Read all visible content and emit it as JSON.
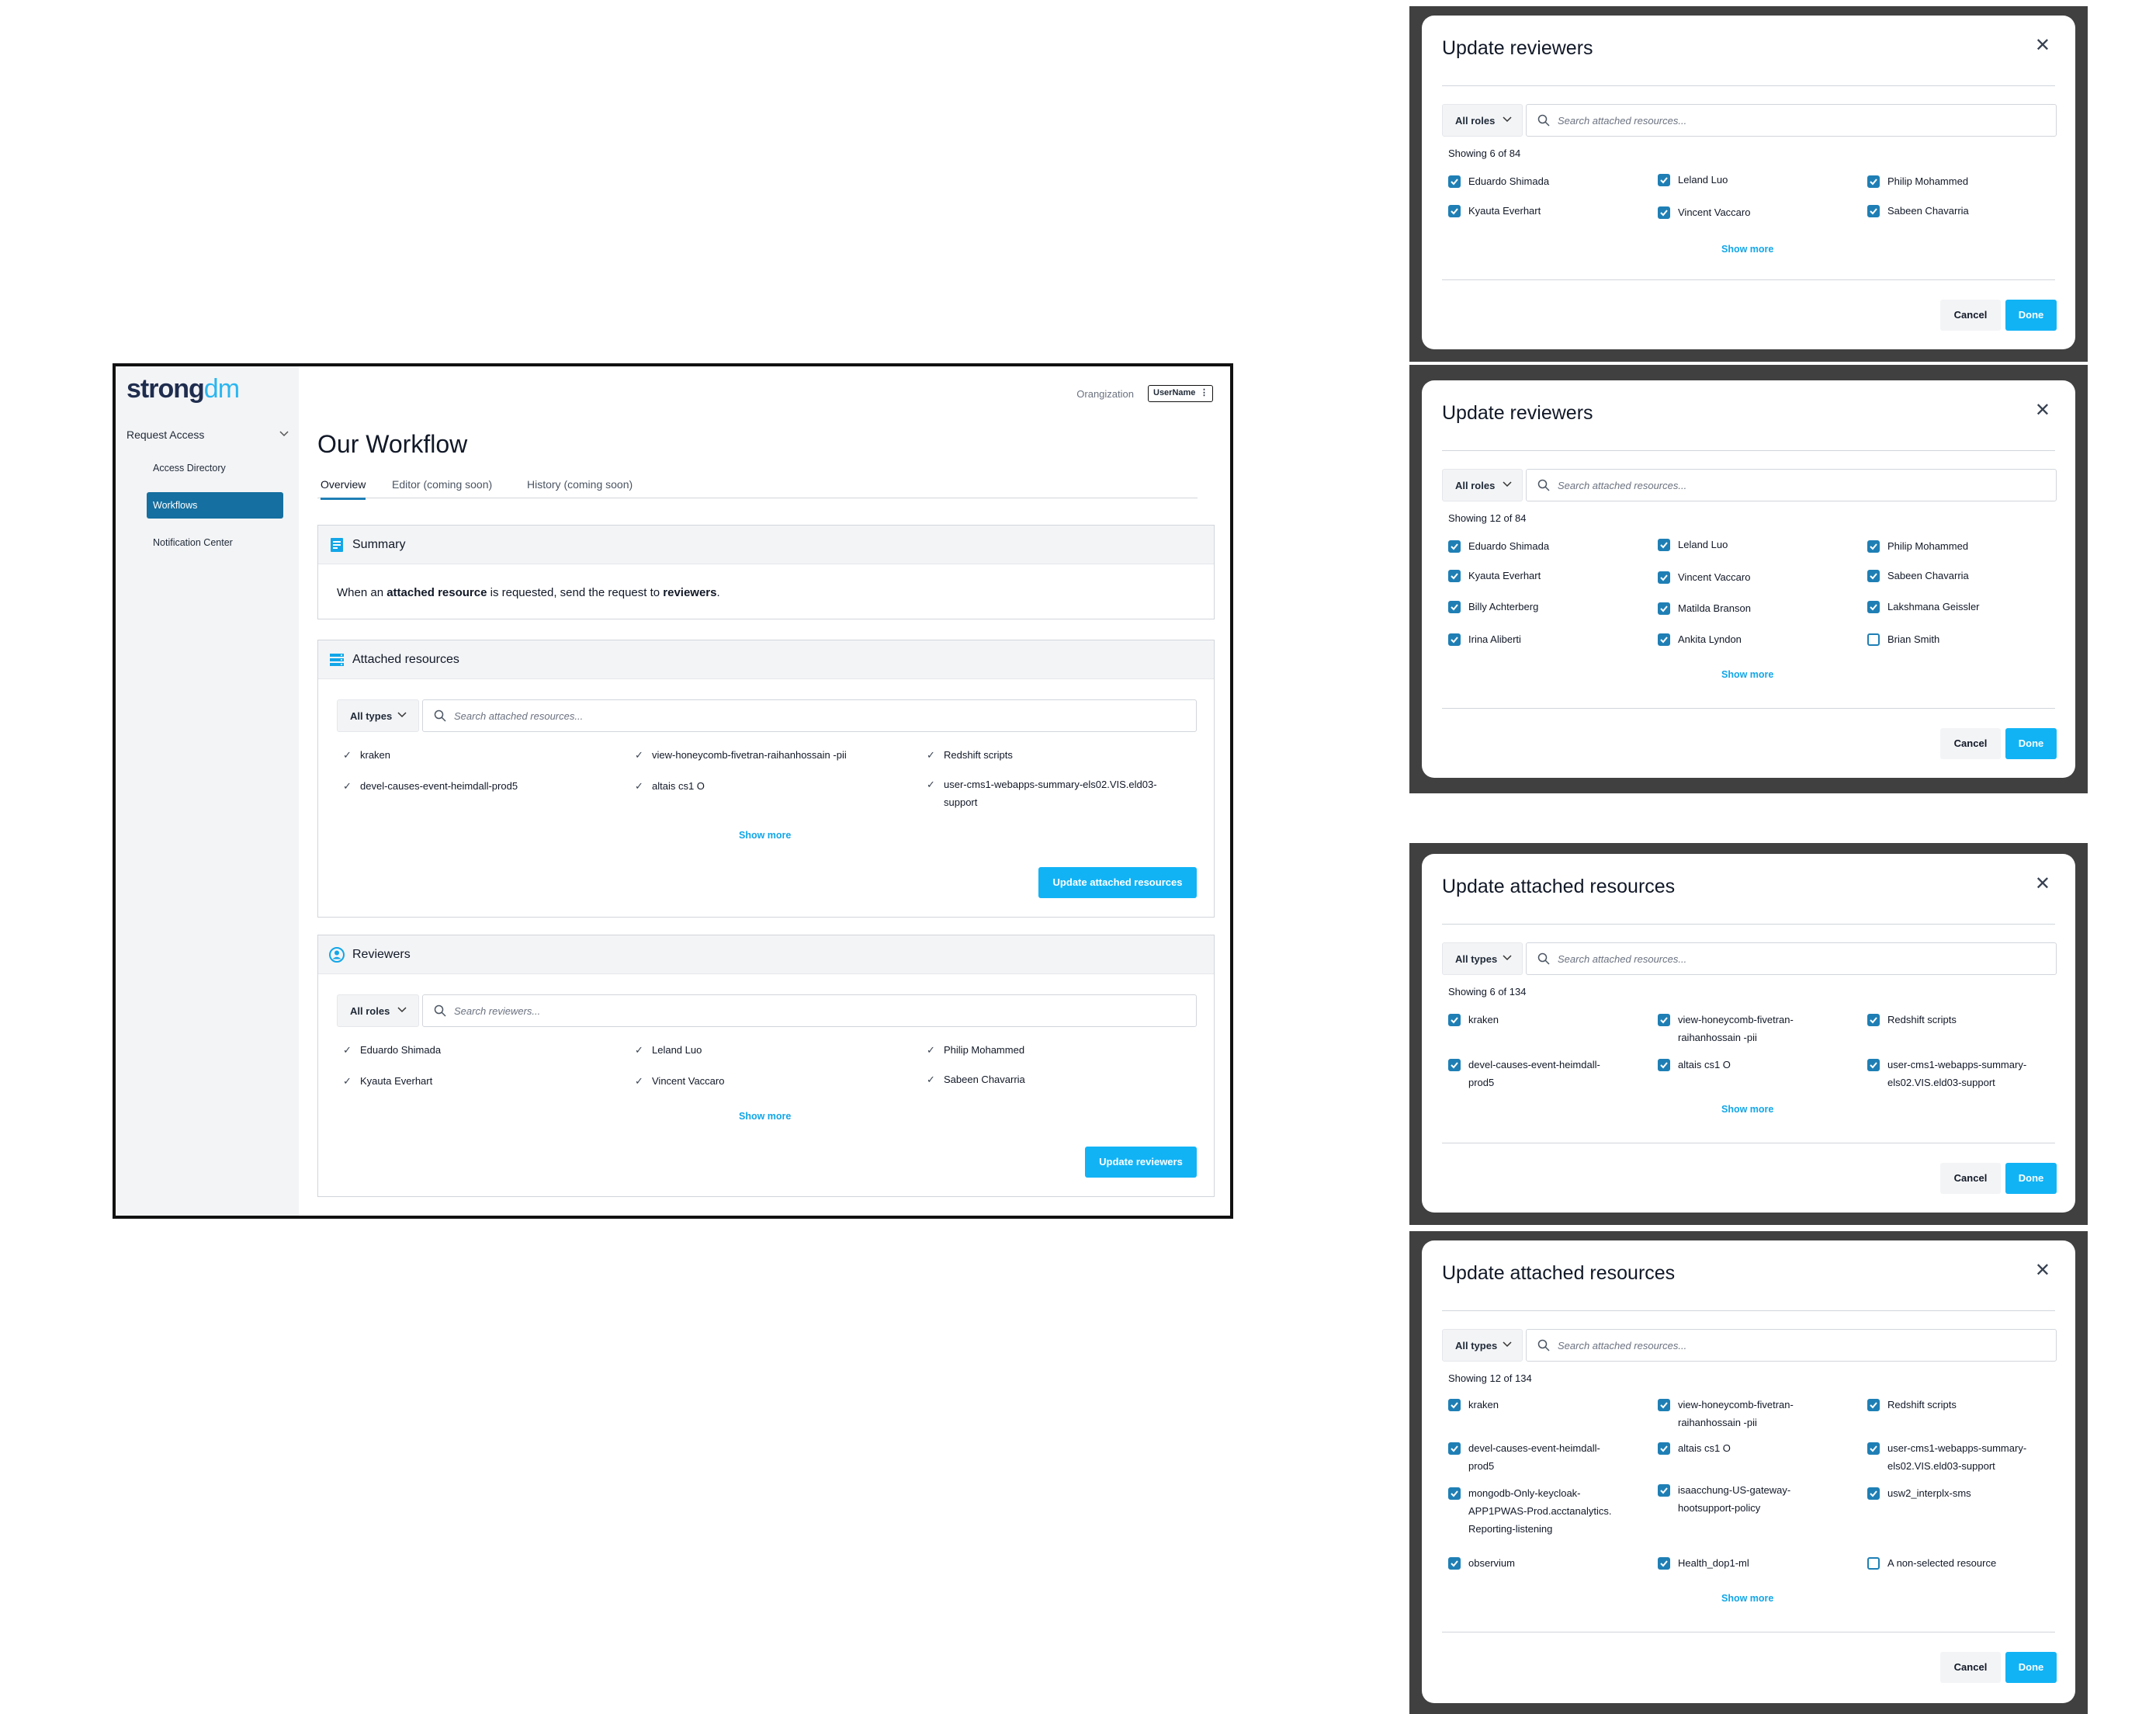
{
  "app": {
    "logo": {
      "part1": "strong",
      "part2": "dm"
    },
    "sidebar": {
      "section": "Request Access",
      "items": [
        {
          "label": "Access Directory",
          "active": false
        },
        {
          "label": "Workflows",
          "active": true
        },
        {
          "label": "Notification Center",
          "active": false
        }
      ]
    },
    "header": {
      "organization_label": "Orangization",
      "user_button": "UserName"
    },
    "page_title": "Our Workflow",
    "tabs": [
      "Overview",
      "Editor (coming soon)",
      "History (coming soon)"
    ],
    "summary": {
      "title": "Summary",
      "text_parts": [
        "When an ",
        "attached resource",
        " is requested, send the request to ",
        "reviewers",
        "."
      ]
    },
    "attached_resources": {
      "title": "Attached resources",
      "filter": "All types",
      "search_placeholder": "Search attached resources...",
      "items": [
        "kraken",
        "view-honeycomb-fivetran-raihanhossain -pii",
        "Redshift scripts",
        "devel-causes-event-heimdall-prod5",
        "altais cs1 O",
        "user-cms1-webapps-summary-els02.VIS.eld03-support"
      ],
      "show_more": "Show more",
      "button": "Update attached resources"
    },
    "reviewers": {
      "title": "Reviewers",
      "filter": "All roles",
      "search_placeholder": "Search reviewers...",
      "items": [
        "Eduardo Shimada",
        "Leland Luo",
        "Philip Mohammed",
        "Kyauta Everhart",
        "Vincent Vaccaro",
        "Sabeen Chavarria"
      ],
      "show_more": "Show more",
      "button": "Update reviewers"
    }
  },
  "modals": [
    {
      "title": "Update reviewers",
      "filter": "All roles",
      "search_placeholder": "Search attached resources...",
      "showing": "Showing 6 of 84",
      "items": [
        {
          "label": "Eduardo Shimada",
          "checked": true
        },
        {
          "label": "Leland Luo",
          "checked": true
        },
        {
          "label": "Philip Mohammed",
          "checked": true
        },
        {
          "label": "Kyauta Everhart",
          "checked": true
        },
        {
          "label": "Vincent Vaccaro",
          "checked": true
        },
        {
          "label": "Sabeen Chavarria",
          "checked": true
        }
      ],
      "show_more": "Show more",
      "cancel": "Cancel",
      "done": "Done"
    },
    {
      "title": "Update reviewers",
      "filter": "All roles",
      "search_placeholder": "Search attached resources...",
      "showing": "Showing 12 of 84",
      "items": [
        {
          "label": "Eduardo Shimada",
          "checked": true
        },
        {
          "label": "Leland Luo",
          "checked": true
        },
        {
          "label": "Philip Mohammed",
          "checked": true
        },
        {
          "label": "Kyauta Everhart",
          "checked": true
        },
        {
          "label": "Vincent Vaccaro",
          "checked": true
        },
        {
          "label": "Sabeen Chavarria",
          "checked": true
        },
        {
          "label": "Billy Achterberg",
          "checked": true
        },
        {
          "label": "Matilda Branson",
          "checked": true
        },
        {
          "label": "Lakshmana Geissler",
          "checked": true
        },
        {
          "label": "Irina Aliberti",
          "checked": true
        },
        {
          "label": "Ankita Lyndon",
          "checked": true
        },
        {
          "label": "Brian Smith",
          "checked": false
        }
      ],
      "show_more": "Show more",
      "cancel": "Cancel",
      "done": "Done"
    },
    {
      "title": "Update attached resources",
      "filter": "All types",
      "search_placeholder": "Search attached resources...",
      "showing": "Showing 6 of 134",
      "items": [
        {
          "label": "kraken",
          "checked": true
        },
        {
          "label": "view-honeycomb-fivetran-\nraihanhossain -pii",
          "checked": true
        },
        {
          "label": "Redshift scripts",
          "checked": true
        },
        {
          "label": "devel-causes-event-heimdall-\nprod5",
          "checked": true
        },
        {
          "label": "altais cs1 O",
          "checked": true
        },
        {
          "label": "user-cms1-webapps-summary-\nels02.VIS.eld03-support",
          "checked": true
        }
      ],
      "show_more": "Show more",
      "cancel": "Cancel",
      "done": "Done"
    },
    {
      "title": "Update attached resources",
      "filter": "All types",
      "search_placeholder": "Search attached resources...",
      "showing": "Showing 12 of 134",
      "items": [
        {
          "label": "kraken",
          "checked": true
        },
        {
          "label": "view-honeycomb-fivetran-\nraihanhossain -pii",
          "checked": true
        },
        {
          "label": "Redshift scripts",
          "checked": true
        },
        {
          "label": "devel-causes-event-heimdall-\nprod5",
          "checked": true
        },
        {
          "label": "altais cs1 O",
          "checked": true
        },
        {
          "label": "user-cms1-webapps-summary-\nels02.VIS.eld03-support",
          "checked": true
        },
        {
          "label": "mongodb-Only-keycloak-\nAPP1PWAS-Prod.acctanalytics.\nReporting-listening",
          "checked": true
        },
        {
          "label": "isaacchung-US-gateway-\nhootsupport-policy",
          "checked": true
        },
        {
          "label": "usw2_interplx-sms",
          "checked": true
        },
        {
          "label": "observium",
          "checked": true
        },
        {
          "label": "Health_dop1-ml",
          "checked": true
        },
        {
          "label": "A non-selected resource",
          "checked": false
        }
      ],
      "show_more": "Show more",
      "cancel": "Cancel",
      "done": "Done"
    }
  ],
  "colors": {
    "accent": "#12b3f5",
    "nav_active": "#156fa0",
    "checkbox": "#1f7fb5",
    "frame": "#404040"
  }
}
